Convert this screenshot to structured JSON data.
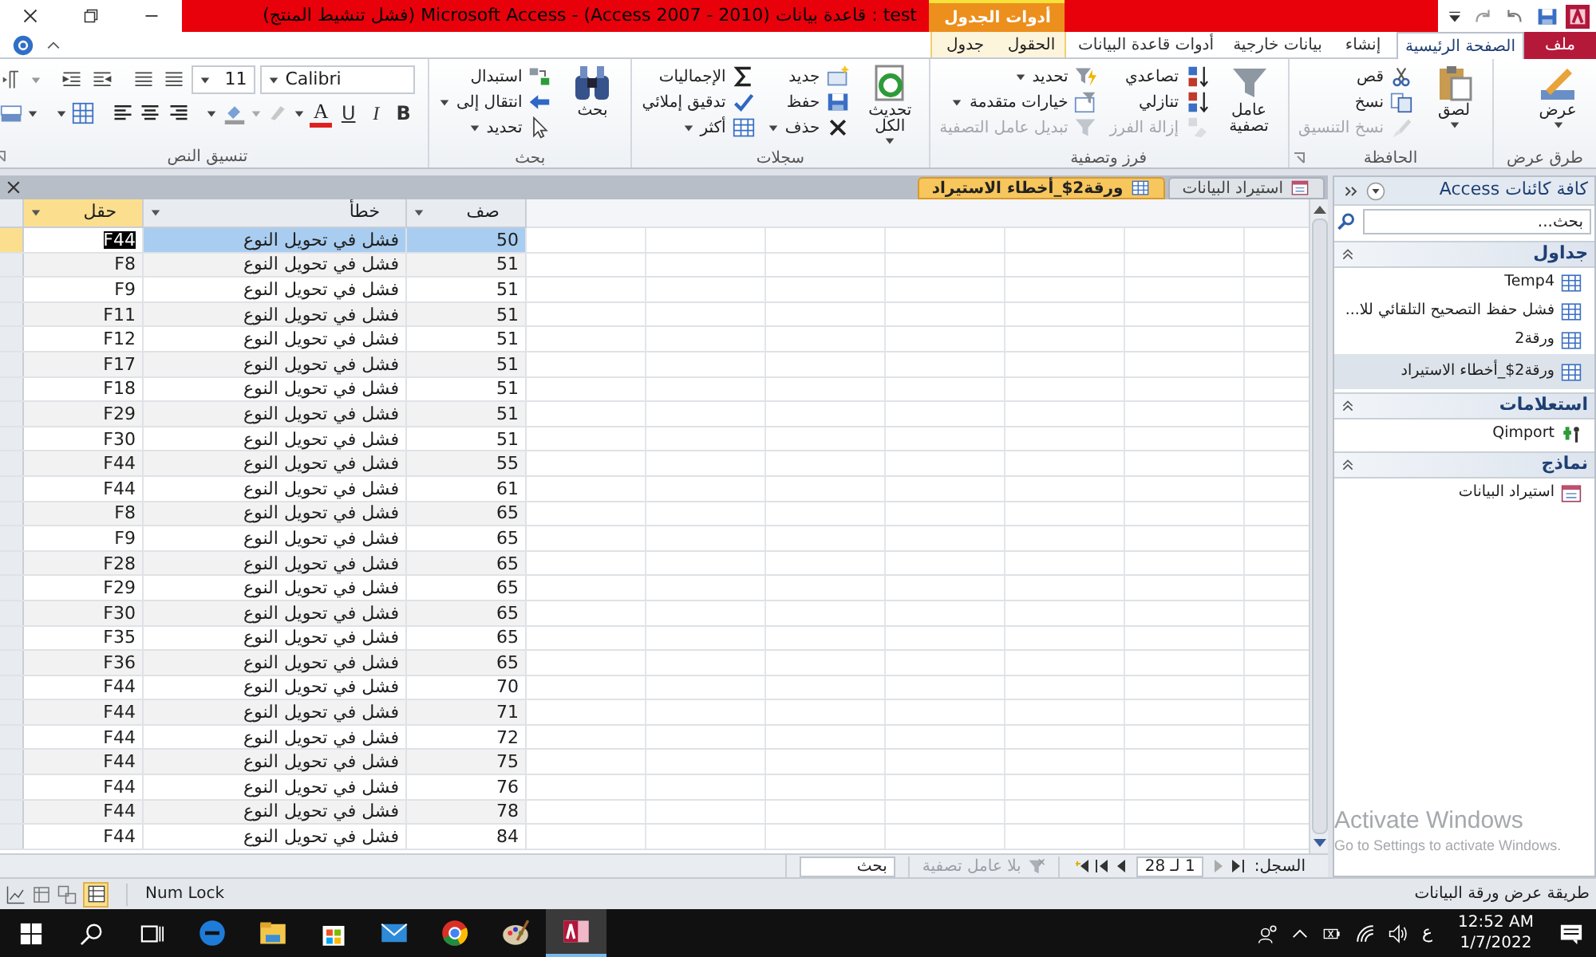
{
  "window": {
    "title": "test : قاعدة بيانات (Access 2007 - 2010) - Microsoft Access (فشل تنشيط المنتج)",
    "context_tab": "أدوات الجدول"
  },
  "ribbon_tabs": [
    {
      "label": "ملف",
      "kind": "file",
      "selected": false
    },
    {
      "label": "الصفحة الرئيسية",
      "kind": "normal",
      "selected": true
    },
    {
      "label": "إنشاء",
      "kind": "normal",
      "selected": false
    },
    {
      "label": "بيانات خارجية",
      "kind": "normal",
      "selected": false
    },
    {
      "label": "أدوات قاعدة البيانات",
      "kind": "normal",
      "selected": false
    },
    {
      "label": "الحقول",
      "kind": "contextual",
      "selected": false
    },
    {
      "label": "جدول",
      "kind": "contextual",
      "selected": false
    }
  ],
  "ribbon_groups": [
    {
      "label": "طرق عرض",
      "launcher": false,
      "buttons": [
        {
          "label": "عرض",
          "kind": "large",
          "dropdown": true,
          "disabled": false
        }
      ]
    },
    {
      "label": "الحافظة",
      "launcher": true,
      "buttons": [
        {
          "label": "لصق",
          "kind": "large",
          "dropdown": true,
          "disabled": false
        },
        {
          "label": "قص",
          "kind": "small",
          "dropdown": false,
          "disabled": false
        },
        {
          "label": "نسخ",
          "kind": "small",
          "dropdown": false,
          "disabled": false
        },
        {
          "label": "نسخ التنسيق",
          "kind": "small",
          "dropdown": false,
          "disabled": true
        }
      ]
    },
    {
      "label": "فرز وتصفية",
      "launcher": false,
      "buttons": [
        {
          "label": "عامل تصفية",
          "kind": "large",
          "dropdown": false,
          "disabled": false
        },
        {
          "label": "تصاعدي",
          "kind": "small",
          "dropdown": false,
          "disabled": false
        },
        {
          "label": "تنازلي",
          "kind": "small",
          "dropdown": false,
          "disabled": false
        },
        {
          "label": "إزالة الفرز",
          "kind": "small",
          "dropdown": false,
          "disabled": true
        },
        {
          "label": "تحديد",
          "kind": "small",
          "dropdown": true,
          "disabled": false
        },
        {
          "label": "خيارات متقدمة",
          "kind": "small",
          "dropdown": true,
          "disabled": false
        },
        {
          "label": "تبديل عامل التصفية",
          "kind": "small",
          "dropdown": false,
          "disabled": true
        }
      ]
    },
    {
      "label": "سجلات",
      "launcher": false,
      "buttons": [
        {
          "label": "تحديث الكل",
          "kind": "large",
          "dropdown": true,
          "disabled": false
        },
        {
          "label": "جديد",
          "kind": "small",
          "dropdown": false,
          "disabled": false
        },
        {
          "label": "حفظ",
          "kind": "small",
          "dropdown": false,
          "disabled": false
        },
        {
          "label": "حذف",
          "kind": "small",
          "dropdown": true,
          "disabled": false
        },
        {
          "label": "الإجماليات",
          "kind": "small",
          "dropdown": false,
          "disabled": false
        },
        {
          "label": "تدقيق إملائي",
          "kind": "small",
          "dropdown": false,
          "disabled": false
        },
        {
          "label": "أكثر",
          "kind": "small",
          "dropdown": true,
          "disabled": false
        }
      ]
    },
    {
      "label": "بحث",
      "launcher": false,
      "buttons": [
        {
          "label": "بحث",
          "kind": "large",
          "dropdown": false,
          "disabled": false
        },
        {
          "label": "استبدال",
          "kind": "small",
          "dropdown": false,
          "disabled": false
        },
        {
          "label": "انتقال إلى",
          "kind": "small",
          "dropdown": true,
          "disabled": false
        },
        {
          "label": "تحديد",
          "kind": "small",
          "dropdown": true,
          "disabled": false
        }
      ]
    }
  ],
  "text_format": {
    "label": "تنسيق النص",
    "font": "Calibri",
    "size": "11",
    "style_buttons": [
      "B",
      "I",
      "U"
    ],
    "font_color": "A"
  },
  "doc_tabs": [
    {
      "label": "استيراد البيانات",
      "kind": "form",
      "selected": false
    },
    {
      "label": "ورقة2$_أخطاء الاستيراد",
      "kind": "table",
      "selected": true
    }
  ],
  "datasheet": {
    "columns": [
      {
        "label": "صف",
        "selected": false
      },
      {
        "label": "خطأ",
        "selected": false
      },
      {
        "label": "حقل",
        "selected": true
      }
    ],
    "rows": [
      {
        "selected": true,
        "cells": [
          "50",
          "فشل في تحويل النوع",
          "F44"
        ]
      },
      {
        "selected": false,
        "cells": [
          "51",
          "فشل في تحويل النوع",
          "F8"
        ]
      },
      {
        "selected": false,
        "cells": [
          "51",
          "فشل في تحويل النوع",
          "F9"
        ]
      },
      {
        "selected": false,
        "cells": [
          "51",
          "فشل في تحويل النوع",
          "F11"
        ]
      },
      {
        "selected": false,
        "cells": [
          "51",
          "فشل في تحويل النوع",
          "F12"
        ]
      },
      {
        "selected": false,
        "cells": [
          "51",
          "فشل في تحويل النوع",
          "F17"
        ]
      },
      {
        "selected": false,
        "cells": [
          "51",
          "فشل في تحويل النوع",
          "F18"
        ]
      },
      {
        "selected": false,
        "cells": [
          "51",
          "فشل في تحويل النوع",
          "F29"
        ]
      },
      {
        "selected": false,
        "cells": [
          "51",
          "فشل في تحويل النوع",
          "F30"
        ]
      },
      {
        "selected": false,
        "cells": [
          "55",
          "فشل في تحويل النوع",
          "F44"
        ]
      },
      {
        "selected": false,
        "cells": [
          "61",
          "فشل في تحويل النوع",
          "F44"
        ]
      },
      {
        "selected": false,
        "cells": [
          "65",
          "فشل في تحويل النوع",
          "F8"
        ]
      },
      {
        "selected": false,
        "cells": [
          "65",
          "فشل في تحويل النوع",
          "F9"
        ]
      },
      {
        "selected": false,
        "cells": [
          "65",
          "فشل في تحويل النوع",
          "F28"
        ]
      },
      {
        "selected": false,
        "cells": [
          "65",
          "فشل في تحويل النوع",
          "F29"
        ]
      },
      {
        "selected": false,
        "cells": [
          "65",
          "فشل في تحويل النوع",
          "F30"
        ]
      },
      {
        "selected": false,
        "cells": [
          "65",
          "فشل في تحويل النوع",
          "F35"
        ]
      },
      {
        "selected": false,
        "cells": [
          "65",
          "فشل في تحويل النوع",
          "F36"
        ]
      },
      {
        "selected": false,
        "cells": [
          "70",
          "فشل في تحويل النوع",
          "F44"
        ]
      },
      {
        "selected": false,
        "cells": [
          "71",
          "فشل في تحويل النوع",
          "F44"
        ]
      },
      {
        "selected": false,
        "cells": [
          "72",
          "فشل في تحويل النوع",
          "F44"
        ]
      },
      {
        "selected": false,
        "cells": [
          "75",
          "فشل في تحويل النوع",
          "F44"
        ]
      },
      {
        "selected": false,
        "cells": [
          "76",
          "فشل في تحويل النوع",
          "F44"
        ]
      },
      {
        "selected": false,
        "cells": [
          "78",
          "فشل في تحويل النوع",
          "F44"
        ]
      },
      {
        "selected": false,
        "cells": [
          "84",
          "فشل في تحويل النوع",
          "F44"
        ]
      }
    ]
  },
  "record_nav": {
    "label": "السجل:",
    "position": "1 لـ 28",
    "filter": "بلا عامل تصفية",
    "search_placeholder": "بحث"
  },
  "nav_pane": {
    "title": "كافة كائنات Access",
    "search_placeholder": "بحث...",
    "groups": [
      {
        "label": "جداول",
        "items": [
          {
            "label": "Temp4",
            "kind": "table",
            "selected": false
          },
          {
            "label": "فشل حفظ التصحيح التلقائي للا...",
            "kind": "table",
            "selected": false
          },
          {
            "label": "ورقة2",
            "kind": "table",
            "selected": false
          },
          {
            "label": "ورقة2$_أخطاء الاستيراد",
            "kind": "table",
            "selected": true
          }
        ]
      },
      {
        "label": "استعلامات",
        "items": [
          {
            "label": "Qimport",
            "kind": "query",
            "selected": false
          }
        ]
      },
      {
        "label": "نماذج",
        "items": [
          {
            "label": "استيراد البيانات",
            "kind": "form",
            "selected": false
          }
        ]
      }
    ]
  },
  "status_bar": {
    "left": "Num Lock",
    "right": "طريقة عرض ورقة البيانات"
  },
  "activation_notice": {
    "title": "Activate Windows",
    "text": "Go to Settings to activate Windows."
  },
  "taskbar": {
    "language": "ع",
    "time": "12:52 AM",
    "date": "1/7/2022"
  }
}
